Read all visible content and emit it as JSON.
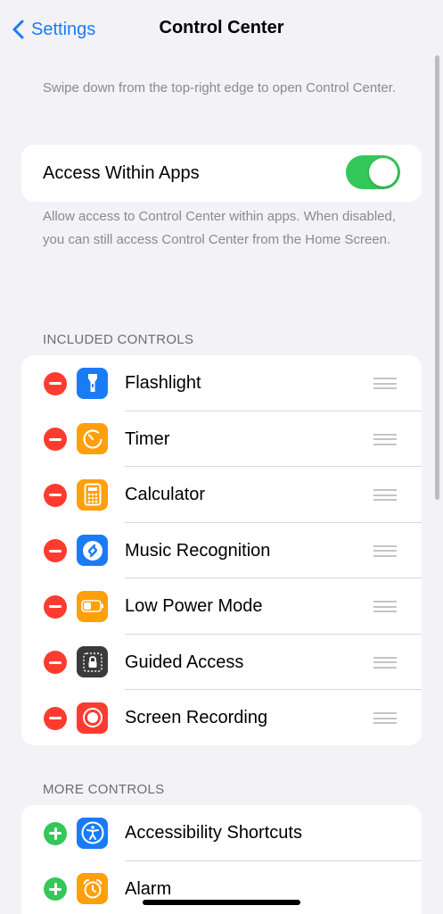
{
  "nav": {
    "back_label": "Settings",
    "title": "Control Center"
  },
  "intro_text": "Swipe down from the top-right edge to open Control Center.",
  "access_within_apps": {
    "label": "Access Within Apps",
    "enabled": true,
    "footnote": "Allow access to Control Center within apps. When disabled, you can still access Control Center from the Home Screen."
  },
  "included_controls": {
    "header": "INCLUDED CONTROLS",
    "items": [
      {
        "label": "Flashlight",
        "icon": "flashlight-icon",
        "color": "#1a7cf5"
      },
      {
        "label": "Timer",
        "icon": "timer-icon",
        "color": "#ff9f0a"
      },
      {
        "label": "Calculator",
        "icon": "calculator-icon",
        "color": "#ff9f0a"
      },
      {
        "label": "Music Recognition",
        "icon": "shazam-icon",
        "color": "#1a7cf5"
      },
      {
        "label": "Low Power Mode",
        "icon": "battery-icon",
        "color": "#ff9f0a"
      },
      {
        "label": "Guided Access",
        "icon": "lock-icon",
        "color": "#3a3a3c"
      },
      {
        "label": "Screen Recording",
        "icon": "record-icon",
        "color": "#ff3b30"
      }
    ]
  },
  "more_controls": {
    "header": "MORE CONTROLS",
    "items": [
      {
        "label": "Accessibility Shortcuts",
        "icon": "accessibility-icon",
        "color": "#1a7cf5"
      },
      {
        "label": "Alarm",
        "icon": "alarm-icon",
        "color": "#ff9f0a"
      }
    ]
  },
  "colors": {
    "accent": "#1a7cf5",
    "toggle_on": "#34c759",
    "remove": "#ff3b30",
    "add": "#34c759",
    "background": "#f2f2f7"
  }
}
